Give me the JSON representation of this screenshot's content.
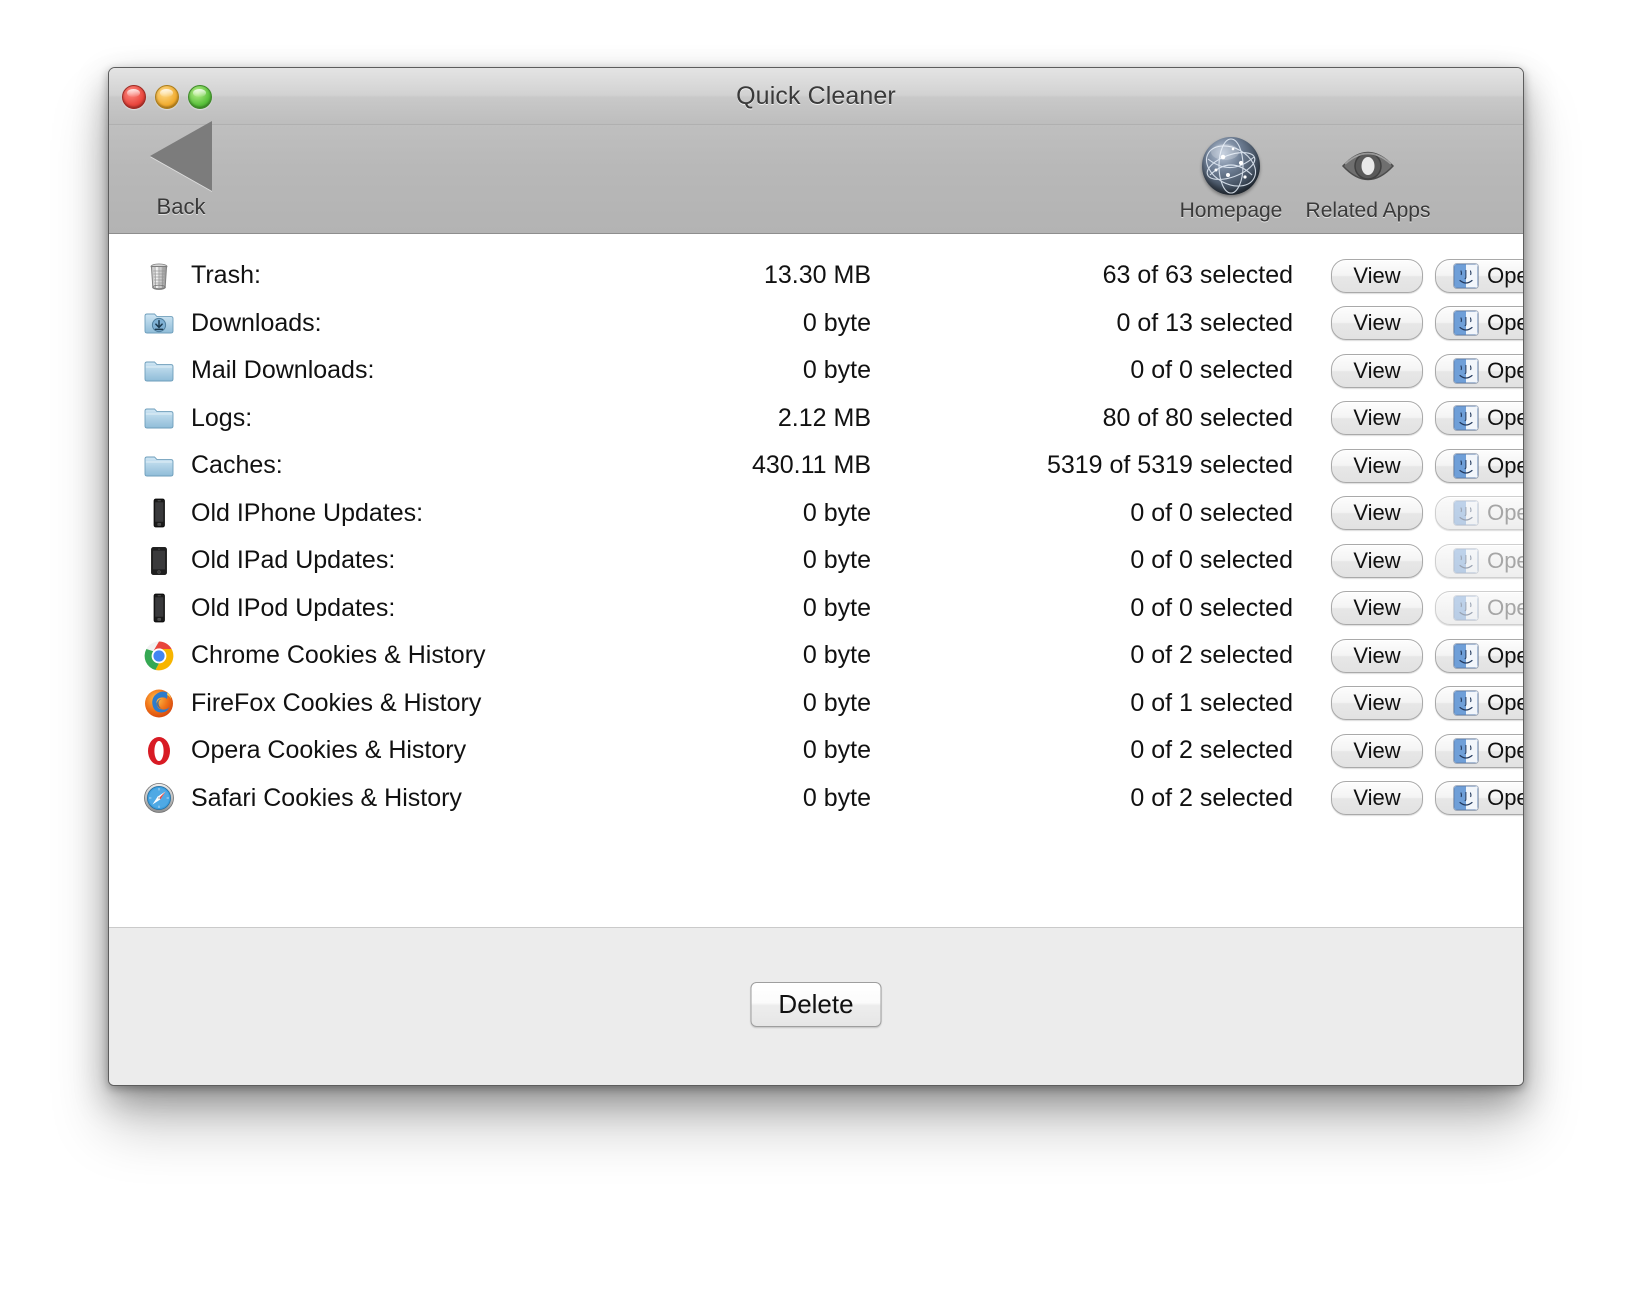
{
  "window": {
    "title": "Quick Cleaner",
    "traffic_lights": [
      "close",
      "minimize",
      "zoom"
    ]
  },
  "toolbar": {
    "back_label": "Back",
    "items": [
      {
        "label": "Homepage",
        "icon": "globe-icon"
      },
      {
        "label": "Related Apps",
        "icon": "eye-icon"
      }
    ]
  },
  "list": {
    "view_label": "View",
    "open_label": "Open",
    "rows": [
      {
        "icon": "trash-icon",
        "name": "Trash:",
        "size": "13.30 MB",
        "selection": "63 of 63 selected",
        "open_enabled": true
      },
      {
        "icon": "downloads-folder-icon",
        "name": "Downloads:",
        "size": "0 byte",
        "selection": "0 of 13 selected",
        "open_enabled": true
      },
      {
        "icon": "folder-icon",
        "name": "Mail Downloads:",
        "size": "0 byte",
        "selection": "0 of 0 selected",
        "open_enabled": true
      },
      {
        "icon": "folder-icon",
        "name": "Logs:",
        "size": "2.12 MB",
        "selection": "80 of 80 selected",
        "open_enabled": true
      },
      {
        "icon": "folder-icon",
        "name": "Caches:",
        "size": "430.11 MB",
        "selection": "5319 of 5319 selected",
        "open_enabled": true
      },
      {
        "icon": "iphone-icon",
        "name": "Old IPhone Updates:",
        "size": "0 byte",
        "selection": "0 of 0 selected",
        "open_enabled": false
      },
      {
        "icon": "ipad-icon",
        "name": "Old IPad Updates:",
        "size": "0 byte",
        "selection": "0 of 0 selected",
        "open_enabled": false
      },
      {
        "icon": "ipod-icon",
        "name": "Old IPod Updates:",
        "size": "0 byte",
        "selection": "0 of 0 selected",
        "open_enabled": false
      },
      {
        "icon": "chrome-icon",
        "name": "Chrome Cookies & History",
        "size": "0 byte",
        "selection": "0 of 2 selected",
        "open_enabled": true
      },
      {
        "icon": "firefox-icon",
        "name": "FireFox Cookies & History",
        "size": "0 byte",
        "selection": "0 of 1 selected",
        "open_enabled": true
      },
      {
        "icon": "opera-icon",
        "name": "Opera Cookies & History",
        "size": "0 byte",
        "selection": "0 of 2 selected",
        "open_enabled": true
      },
      {
        "icon": "safari-icon",
        "name": "Safari Cookies & History",
        "size": "0 byte",
        "selection": "0 of 2 selected",
        "open_enabled": true
      }
    ]
  },
  "footer": {
    "delete_label": "Delete"
  },
  "colors": {
    "titlebar_top": "#e4e4e4",
    "toolbar": "#b8b8b8",
    "content_bg": "#ffffff",
    "footer_bg": "#ececec",
    "text": "#111111",
    "disabled_text": "#a6a6a6",
    "chrome_red": "#e8453c",
    "chrome_green": "#35a853",
    "chrome_yellow": "#f7b500",
    "chrome_blue": "#4285f4",
    "firefox_orange": "#e66000",
    "opera_red": "#d81b24",
    "safari_blue": "#3b9ede",
    "folder_blue": "#9ec7e0"
  }
}
